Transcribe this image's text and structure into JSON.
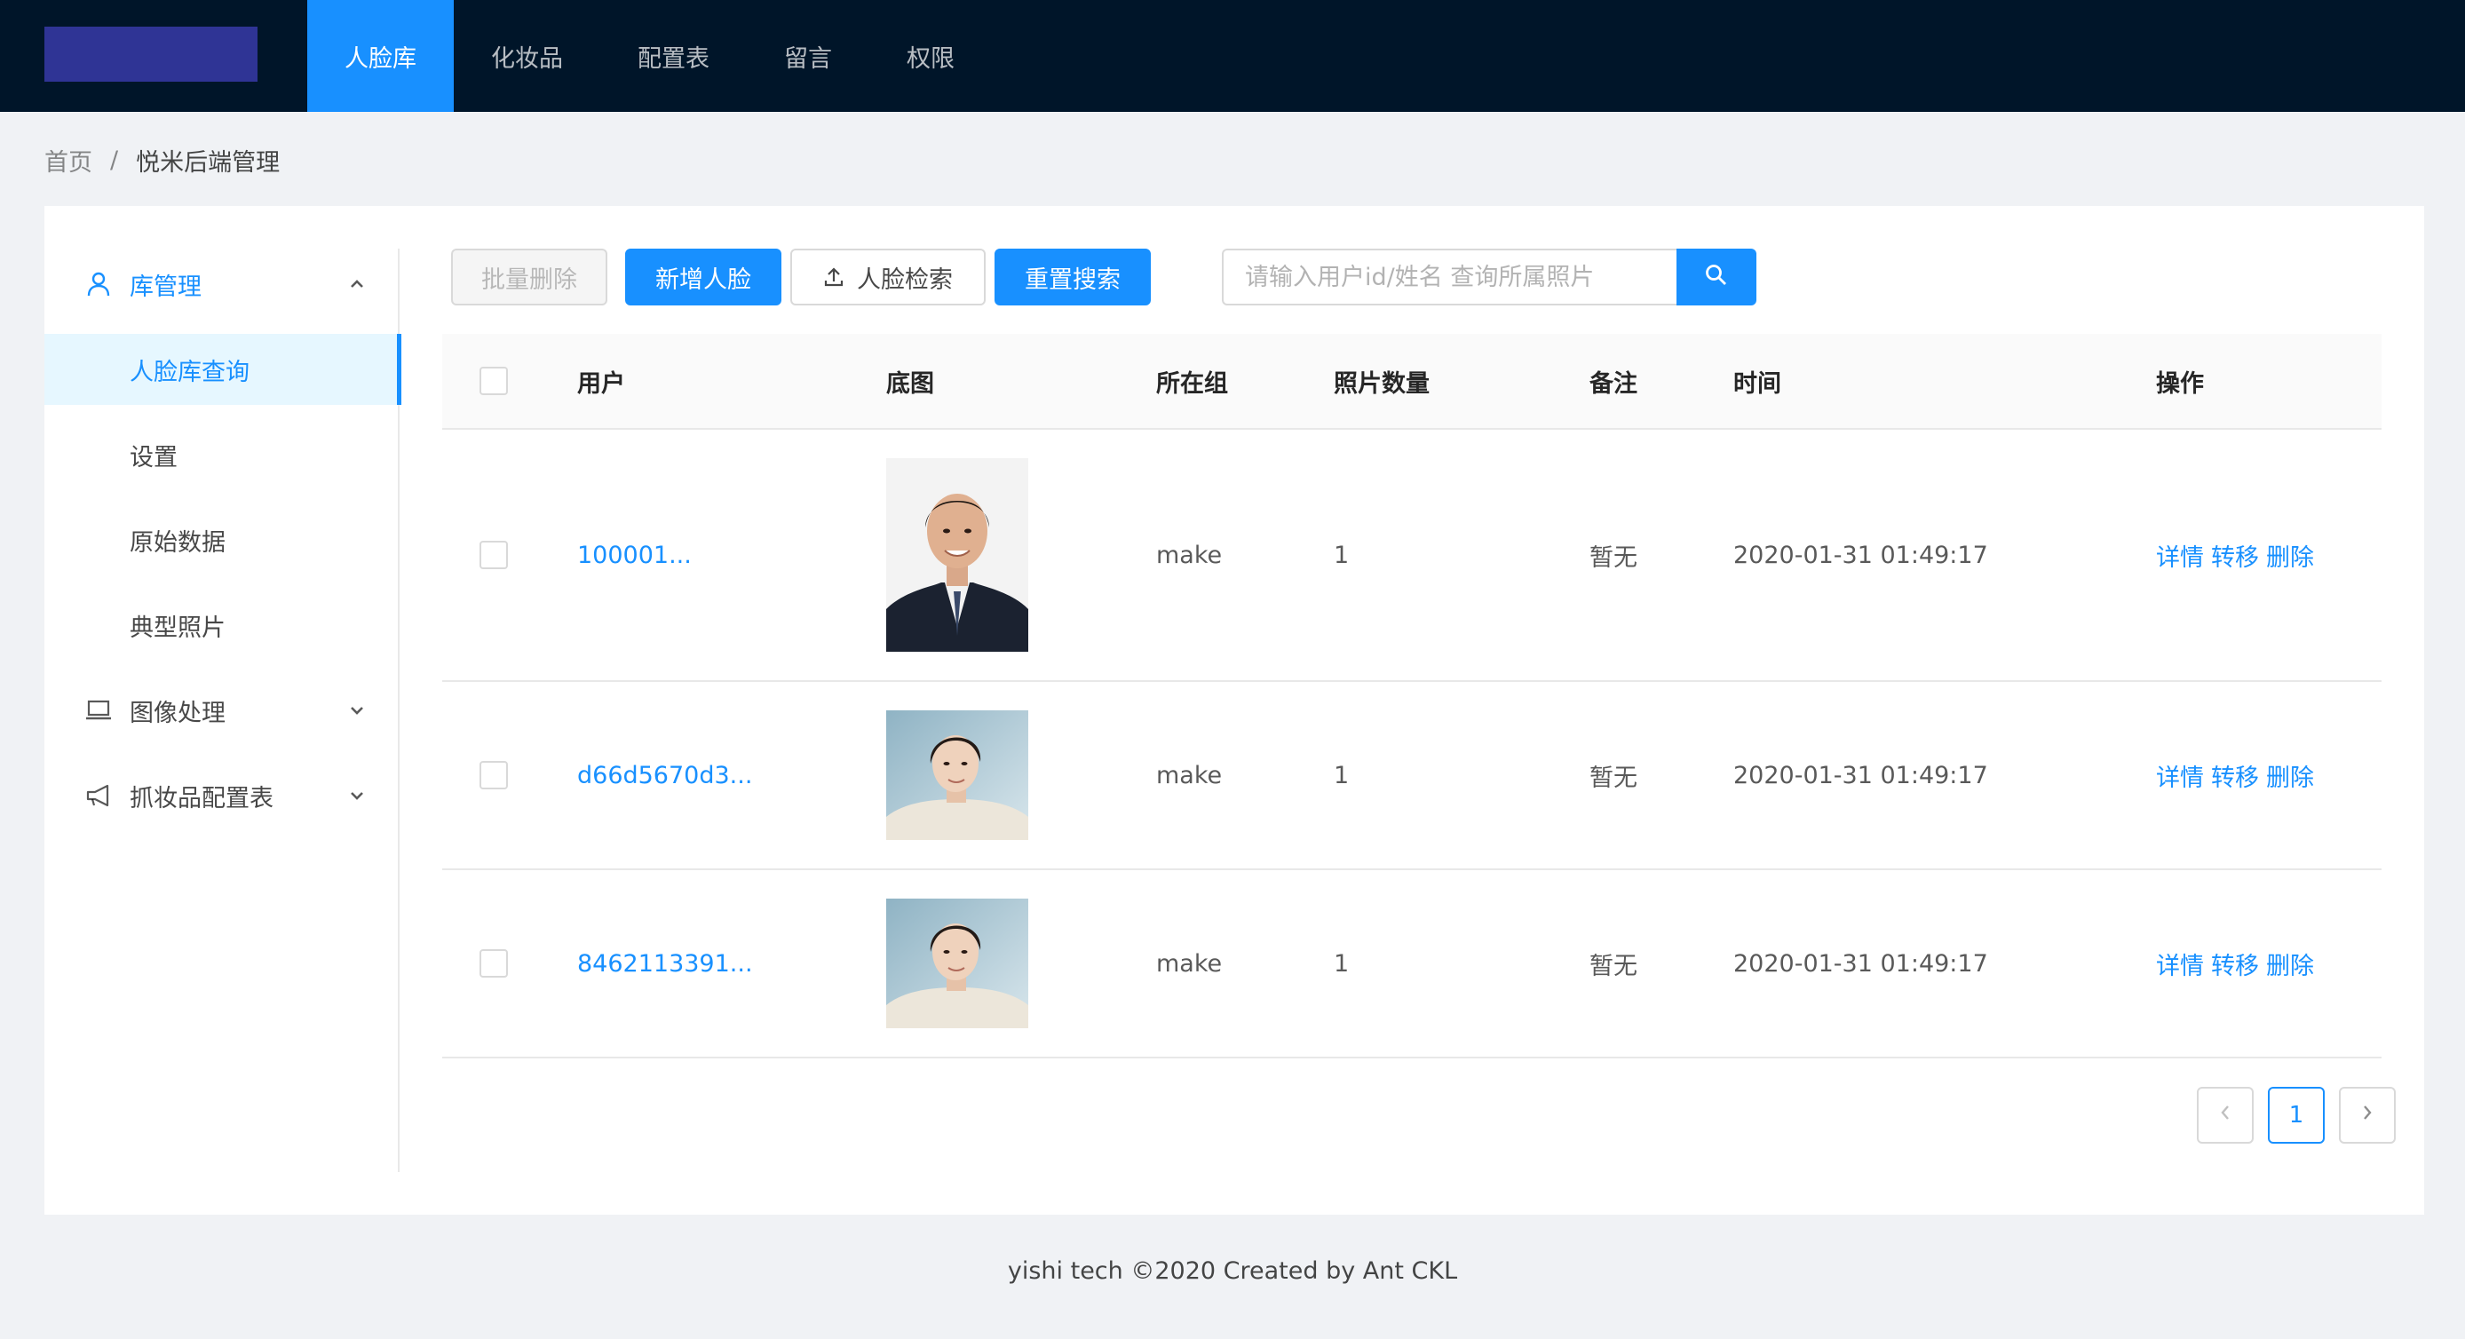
{
  "header": {
    "nav": [
      {
        "label": "人脸库",
        "active": true
      },
      {
        "label": "化妆品",
        "active": false
      },
      {
        "label": "配置表",
        "active": false
      },
      {
        "label": "留言",
        "active": false
      },
      {
        "label": "权限",
        "active": false
      }
    ],
    "colors": {
      "bg": "#001529",
      "active": "#1890ff",
      "logo": "#2f3495"
    }
  },
  "breadcrumb": {
    "home": "首页",
    "separator": "/",
    "current": "悦米后端管理"
  },
  "sidebar": {
    "groups": [
      {
        "label": "库管理",
        "icon": "user-icon",
        "expanded": true,
        "children": [
          "人脸库查询",
          "设置",
          "原始数据",
          "典型照片"
        ],
        "selected": "人脸库查询"
      },
      {
        "label": "图像处理",
        "icon": "laptop-icon",
        "expanded": false
      },
      {
        "label": "抓妆品配置表",
        "icon": "notification-icon",
        "expanded": false
      }
    ]
  },
  "toolbar": {
    "batch_delete": "批量删除",
    "add_face": "新增人脸",
    "face_search": "人脸检索",
    "reset_search": "重置搜索",
    "search_placeholder": "请输入用户id/姓名 查询所属照片"
  },
  "table": {
    "columns": [
      "用户",
      "底图",
      "所在组",
      "照片数量",
      "备注",
      "时间",
      "操作"
    ],
    "rows": [
      {
        "user": "100001...",
        "group": "make",
        "count": "1",
        "note": "暂无",
        "time": "2020-01-31 01:49:17"
      },
      {
        "user": "d66d5670d3...",
        "group": "make",
        "count": "1",
        "note": "暂无",
        "time": "2020-01-31 01:49:17"
      },
      {
        "user": "8462113391...",
        "group": "make",
        "count": "1",
        "note": "暂无",
        "time": "2020-01-31 01:49:17"
      }
    ],
    "ops": {
      "detail": "详情",
      "transfer": "转移",
      "delete": "删除"
    }
  },
  "pagination": {
    "prev": "‹",
    "current": "1",
    "next": "›"
  },
  "footer": {
    "text": "yishi tech ©2020 Created by Ant CKL"
  }
}
